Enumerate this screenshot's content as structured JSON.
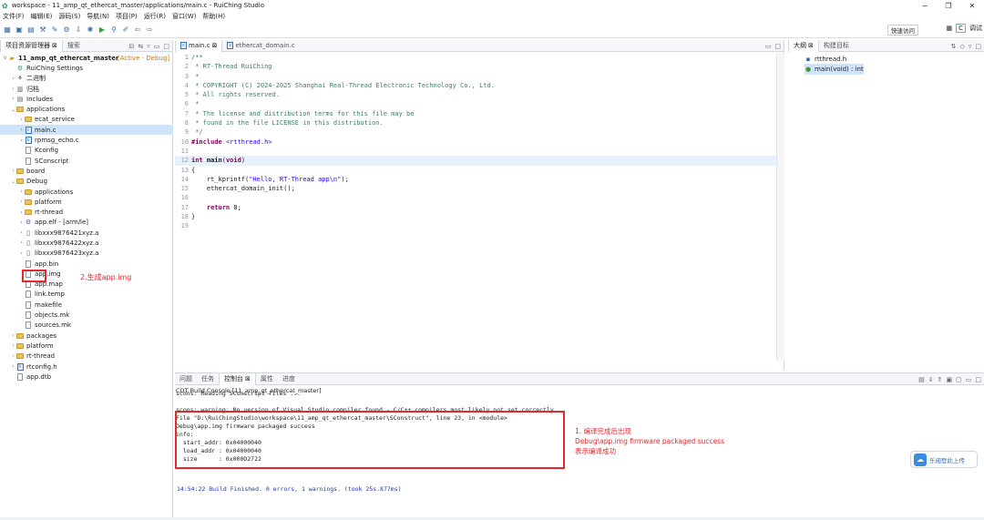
{
  "window": {
    "title": "workspace - 11_amp_qt_ethercat_master/applications/main.c - RuiChing Studio"
  },
  "menu": [
    "文件(F)",
    "编辑(E)",
    "源码(S)",
    "导航(N)",
    "项目(P)",
    "运行(R)",
    "窗口(W)",
    "帮助(H)"
  ],
  "toolbar": {
    "quick_access": "快速访问",
    "perspective_c": "C",
    "perspective_debug": "调试"
  },
  "explorer": {
    "tabs": [
      "项目资源管理器",
      "搜索"
    ],
    "project": "11_amp_qt_ethercat_master",
    "active_tag": "[Active - Debug]",
    "items": [
      {
        "label": "RuiChing Settings",
        "indent": 1,
        "icon": "gear",
        "tw": ""
      },
      {
        "label": "二进制",
        "indent": 1,
        "icon": "binary",
        "tw": ">"
      },
      {
        "label": "归档",
        "indent": 1,
        "icon": "archive",
        "tw": ">"
      },
      {
        "label": "Includes",
        "indent": 1,
        "icon": "includes",
        "tw": ">"
      },
      {
        "label": "applications",
        "indent": 1,
        "icon": "folder",
        "tw": "v"
      },
      {
        "label": "ecat_service",
        "indent": 2,
        "icon": "folder",
        "tw": ">"
      },
      {
        "label": "main.c",
        "indent": 2,
        "icon": "c",
        "tw": ">",
        "selected": true
      },
      {
        "label": "rpmsg_echo.c",
        "indent": 2,
        "icon": "c",
        "tw": ">"
      },
      {
        "label": "Kconfig",
        "indent": 2,
        "icon": "file",
        "tw": ""
      },
      {
        "label": "SConscript",
        "indent": 2,
        "icon": "file",
        "tw": ""
      },
      {
        "label": "board",
        "indent": 1,
        "icon": "folder",
        "tw": ">"
      },
      {
        "label": "Debug",
        "indent": 1,
        "icon": "folder",
        "tw": "v"
      },
      {
        "label": "applications",
        "indent": 2,
        "icon": "folder",
        "tw": ">"
      },
      {
        "label": "platform",
        "indent": 2,
        "icon": "folder",
        "tw": ">"
      },
      {
        "label": "rt-thread",
        "indent": 2,
        "icon": "folder",
        "tw": ">"
      },
      {
        "label": "app.elf - [arm/le]",
        "indent": 2,
        "icon": "elf",
        "tw": ">"
      },
      {
        "label": "libxxx9876421xyz.a",
        "indent": 2,
        "icon": "lib",
        "tw": ">"
      },
      {
        "label": "libxxx9876422xyz.a",
        "indent": 2,
        "icon": "lib",
        "tw": ">"
      },
      {
        "label": "libxxx9876423xyz.a",
        "indent": 2,
        "icon": "lib",
        "tw": ">"
      },
      {
        "label": "app.bin",
        "indent": 2,
        "icon": "file",
        "tw": ""
      },
      {
        "label": "app.img",
        "indent": 2,
        "icon": "file",
        "tw": ""
      },
      {
        "label": "app.map",
        "indent": 2,
        "icon": "file",
        "tw": ""
      },
      {
        "label": "link.temp",
        "indent": 2,
        "icon": "file",
        "tw": ""
      },
      {
        "label": "makefile",
        "indent": 2,
        "icon": "file",
        "tw": ""
      },
      {
        "label": "objects.mk",
        "indent": 2,
        "icon": "file",
        "tw": ""
      },
      {
        "label": "sources.mk",
        "indent": 2,
        "icon": "file",
        "tw": ""
      },
      {
        "label": "packages",
        "indent": 1,
        "icon": "folder",
        "tw": ">"
      },
      {
        "label": "platform",
        "indent": 1,
        "icon": "folder",
        "tw": ">"
      },
      {
        "label": "rt-thread",
        "indent": 1,
        "icon": "folder",
        "tw": ">"
      },
      {
        "label": "rtconfig.h",
        "indent": 1,
        "icon": "h",
        "tw": ">"
      },
      {
        "label": "app.dtb",
        "indent": 1,
        "icon": "file",
        "tw": ""
      }
    ],
    "callout": "2.生成app.img"
  },
  "editor": {
    "tabs": [
      "main.c",
      "ethercat_domain.c"
    ],
    "lines": [
      {
        "n": "1",
        "t": "/**",
        "k": "cm"
      },
      {
        "n": "2",
        "t": " * RT-Thread RuiChing",
        "k": "cm"
      },
      {
        "n": "3",
        "t": " *",
        "k": "cm"
      },
      {
        "n": "4",
        "t": " * COPYRIGHT (C) 2024-2025 Shanghai Real-Thread Electronic Technology Co., Ltd.",
        "k": "cm"
      },
      {
        "n": "5",
        "t": " * All rights reserved.",
        "k": "cm"
      },
      {
        "n": "6",
        "t": " *",
        "k": "cm"
      },
      {
        "n": "7",
        "t": " * The license and distribution terms for this file may be",
        "k": "cm"
      },
      {
        "n": "8",
        "t": " * found in the file LICENSE in this distribution.",
        "k": "cm"
      },
      {
        "n": "9",
        "t": " */",
        "k": "cm"
      },
      {
        "n": "10",
        "t": "#include <rtthread.h>",
        "k": "inc"
      },
      {
        "n": "11",
        "t": "",
        "k": ""
      },
      {
        "n": "12",
        "t": "int main(void)",
        "k": "fn"
      },
      {
        "n": "13",
        "t": "{",
        "k": ""
      },
      {
        "n": "14",
        "t": "    rt_kprintf(\"Hello, RT-Thread app\\n\");",
        "k": "call"
      },
      {
        "n": "15",
        "t": "    ethercat_domain_init();",
        "k": ""
      },
      {
        "n": "16",
        "t": "",
        "k": ""
      },
      {
        "n": "17",
        "t": "    return 0;",
        "k": "ret"
      },
      {
        "n": "18",
        "t": "}",
        "k": ""
      },
      {
        "n": "19",
        "t": "",
        "k": ""
      }
    ]
  },
  "outline": {
    "tabs": [
      "大纲",
      "构建目标"
    ],
    "items": [
      "rtthread.h",
      "main(void) : int"
    ]
  },
  "console": {
    "tabs": [
      "问题",
      "任务",
      "控制台",
      "属性",
      "进度"
    ],
    "header": "CDT Build Console [11_amp_qt_ethercat_master]",
    "lines": [
      "scons: Reading SConscript files ...",
      "",
      "scons: warning: No version of Visual Studio compiler found - C/C++ compilers most likely not set correctly",
      "File \"D:\\RuiChingStudio\\workspace\\11_amp_qt_ethercat_master\\SConstruct\", line 23, in <module>",
      "Debug\\app.img firmware packaged success",
      "info:",
      "  start_addr: 0x04000040",
      "  load_addr : 0x04000040",
      "  size      : 0x000D2722"
    ],
    "finished": "14:54:22 Build Finished. 0 errors, 1 warnings. (took 25s.877ms)",
    "note": [
      "1. 编译完成后出现",
      "Debug\\app.img firmware packaged success",
      "表示编译成功"
    ]
  },
  "cloud_button": "乐阅登此上传"
}
